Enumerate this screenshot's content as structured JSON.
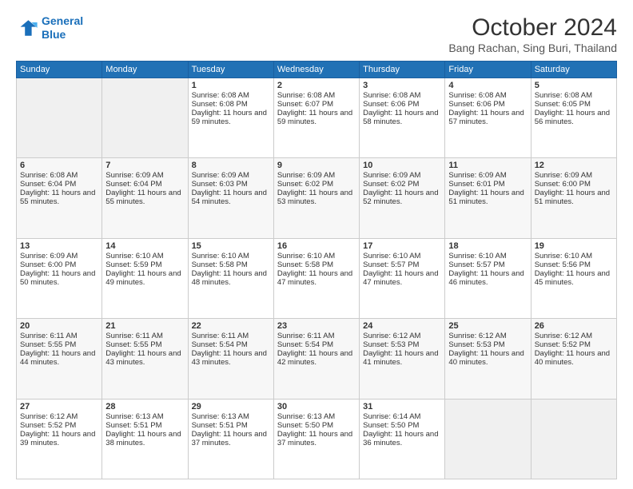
{
  "logo": {
    "line1": "General",
    "line2": "Blue"
  },
  "title": "October 2024",
  "location": "Bang Rachan, Sing Buri, Thailand",
  "days_of_week": [
    "Sunday",
    "Monday",
    "Tuesday",
    "Wednesday",
    "Thursday",
    "Friday",
    "Saturday"
  ],
  "weeks": [
    [
      {
        "day": "",
        "sunrise": "",
        "sunset": "",
        "daylight": ""
      },
      {
        "day": "",
        "sunrise": "",
        "sunset": "",
        "daylight": ""
      },
      {
        "day": "1",
        "sunrise": "Sunrise: 6:08 AM",
        "sunset": "Sunset: 6:08 PM",
        "daylight": "Daylight: 11 hours and 59 minutes."
      },
      {
        "day": "2",
        "sunrise": "Sunrise: 6:08 AM",
        "sunset": "Sunset: 6:07 PM",
        "daylight": "Daylight: 11 hours and 59 minutes."
      },
      {
        "day": "3",
        "sunrise": "Sunrise: 6:08 AM",
        "sunset": "Sunset: 6:06 PM",
        "daylight": "Daylight: 11 hours and 58 minutes."
      },
      {
        "day": "4",
        "sunrise": "Sunrise: 6:08 AM",
        "sunset": "Sunset: 6:06 PM",
        "daylight": "Daylight: 11 hours and 57 minutes."
      },
      {
        "day": "5",
        "sunrise": "Sunrise: 6:08 AM",
        "sunset": "Sunset: 6:05 PM",
        "daylight": "Daylight: 11 hours and 56 minutes."
      }
    ],
    [
      {
        "day": "6",
        "sunrise": "Sunrise: 6:08 AM",
        "sunset": "Sunset: 6:04 PM",
        "daylight": "Daylight: 11 hours and 55 minutes."
      },
      {
        "day": "7",
        "sunrise": "Sunrise: 6:09 AM",
        "sunset": "Sunset: 6:04 PM",
        "daylight": "Daylight: 11 hours and 55 minutes."
      },
      {
        "day": "8",
        "sunrise": "Sunrise: 6:09 AM",
        "sunset": "Sunset: 6:03 PM",
        "daylight": "Daylight: 11 hours and 54 minutes."
      },
      {
        "day": "9",
        "sunrise": "Sunrise: 6:09 AM",
        "sunset": "Sunset: 6:02 PM",
        "daylight": "Daylight: 11 hours and 53 minutes."
      },
      {
        "day": "10",
        "sunrise": "Sunrise: 6:09 AM",
        "sunset": "Sunset: 6:02 PM",
        "daylight": "Daylight: 11 hours and 52 minutes."
      },
      {
        "day": "11",
        "sunrise": "Sunrise: 6:09 AM",
        "sunset": "Sunset: 6:01 PM",
        "daylight": "Daylight: 11 hours and 51 minutes."
      },
      {
        "day": "12",
        "sunrise": "Sunrise: 6:09 AM",
        "sunset": "Sunset: 6:00 PM",
        "daylight": "Daylight: 11 hours and 51 minutes."
      }
    ],
    [
      {
        "day": "13",
        "sunrise": "Sunrise: 6:09 AM",
        "sunset": "Sunset: 6:00 PM",
        "daylight": "Daylight: 11 hours and 50 minutes."
      },
      {
        "day": "14",
        "sunrise": "Sunrise: 6:10 AM",
        "sunset": "Sunset: 5:59 PM",
        "daylight": "Daylight: 11 hours and 49 minutes."
      },
      {
        "day": "15",
        "sunrise": "Sunrise: 6:10 AM",
        "sunset": "Sunset: 5:58 PM",
        "daylight": "Daylight: 11 hours and 48 minutes."
      },
      {
        "day": "16",
        "sunrise": "Sunrise: 6:10 AM",
        "sunset": "Sunset: 5:58 PM",
        "daylight": "Daylight: 11 hours and 47 minutes."
      },
      {
        "day": "17",
        "sunrise": "Sunrise: 6:10 AM",
        "sunset": "Sunset: 5:57 PM",
        "daylight": "Daylight: 11 hours and 47 minutes."
      },
      {
        "day": "18",
        "sunrise": "Sunrise: 6:10 AM",
        "sunset": "Sunset: 5:57 PM",
        "daylight": "Daylight: 11 hours and 46 minutes."
      },
      {
        "day": "19",
        "sunrise": "Sunrise: 6:10 AM",
        "sunset": "Sunset: 5:56 PM",
        "daylight": "Daylight: 11 hours and 45 minutes."
      }
    ],
    [
      {
        "day": "20",
        "sunrise": "Sunrise: 6:11 AM",
        "sunset": "Sunset: 5:55 PM",
        "daylight": "Daylight: 11 hours and 44 minutes."
      },
      {
        "day": "21",
        "sunrise": "Sunrise: 6:11 AM",
        "sunset": "Sunset: 5:55 PM",
        "daylight": "Daylight: 11 hours and 43 minutes."
      },
      {
        "day": "22",
        "sunrise": "Sunrise: 6:11 AM",
        "sunset": "Sunset: 5:54 PM",
        "daylight": "Daylight: 11 hours and 43 minutes."
      },
      {
        "day": "23",
        "sunrise": "Sunrise: 6:11 AM",
        "sunset": "Sunset: 5:54 PM",
        "daylight": "Daylight: 11 hours and 42 minutes."
      },
      {
        "day": "24",
        "sunrise": "Sunrise: 6:12 AM",
        "sunset": "Sunset: 5:53 PM",
        "daylight": "Daylight: 11 hours and 41 minutes."
      },
      {
        "day": "25",
        "sunrise": "Sunrise: 6:12 AM",
        "sunset": "Sunset: 5:53 PM",
        "daylight": "Daylight: 11 hours and 40 minutes."
      },
      {
        "day": "26",
        "sunrise": "Sunrise: 6:12 AM",
        "sunset": "Sunset: 5:52 PM",
        "daylight": "Daylight: 11 hours and 40 minutes."
      }
    ],
    [
      {
        "day": "27",
        "sunrise": "Sunrise: 6:12 AM",
        "sunset": "Sunset: 5:52 PM",
        "daylight": "Daylight: 11 hours and 39 minutes."
      },
      {
        "day": "28",
        "sunrise": "Sunrise: 6:13 AM",
        "sunset": "Sunset: 5:51 PM",
        "daylight": "Daylight: 11 hours and 38 minutes."
      },
      {
        "day": "29",
        "sunrise": "Sunrise: 6:13 AM",
        "sunset": "Sunset: 5:51 PM",
        "daylight": "Daylight: 11 hours and 37 minutes."
      },
      {
        "day": "30",
        "sunrise": "Sunrise: 6:13 AM",
        "sunset": "Sunset: 5:50 PM",
        "daylight": "Daylight: 11 hours and 37 minutes."
      },
      {
        "day": "31",
        "sunrise": "Sunrise: 6:14 AM",
        "sunset": "Sunset: 5:50 PM",
        "daylight": "Daylight: 11 hours and 36 minutes."
      },
      {
        "day": "",
        "sunrise": "",
        "sunset": "",
        "daylight": ""
      },
      {
        "day": "",
        "sunrise": "",
        "sunset": "",
        "daylight": ""
      }
    ]
  ]
}
